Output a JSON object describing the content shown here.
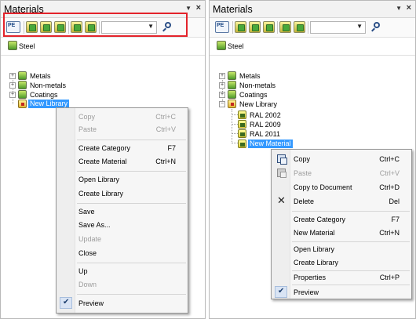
{
  "left_panel": {
    "title": "Materials",
    "pin_icon": "pin-icon",
    "close_icon": "close-icon",
    "toolbar": {
      "pe_label": "PE",
      "search_icon": "search-icon",
      "highlight_color": "#e3232b"
    },
    "header_item": "Steel",
    "tree": [
      "Metals",
      "Non-metals",
      "Coatings",
      "New Library"
    ],
    "context_menu": [
      {
        "label": "Copy",
        "shortcut": "Ctrl+C",
        "disabled": true
      },
      {
        "label": "Paste",
        "shortcut": "Ctrl+V",
        "disabled": true
      },
      {
        "label": "Create Category",
        "shortcut": "F7"
      },
      {
        "label": "Create Material",
        "shortcut": "Ctrl+N"
      },
      {
        "label": "Open Library",
        "shortcut": ""
      },
      {
        "label": "Create Library",
        "shortcut": ""
      },
      {
        "label": "Save",
        "shortcut": ""
      },
      {
        "label": "Save As...",
        "shortcut": ""
      },
      {
        "label": "Update",
        "shortcut": "",
        "disabled": true
      },
      {
        "label": "Close",
        "shortcut": ""
      },
      {
        "label": "Up",
        "shortcut": ""
      },
      {
        "label": "Down",
        "shortcut": "",
        "disabled": true
      },
      {
        "label": "Preview",
        "shortcut": "",
        "checked": true
      }
    ]
  },
  "right_panel": {
    "title": "Materials",
    "pin_icon": "pin-icon",
    "close_icon": "close-icon",
    "toolbar": {
      "pe_label": "PE",
      "search_icon": "search-icon"
    },
    "header_item": "Steel",
    "tree": [
      "Metals",
      "Non-metals",
      "Coatings",
      "New Library",
      "RAL 2002",
      "RAL 2009",
      "RAL 2011",
      "New Material"
    ],
    "context_menu": [
      {
        "label": "Copy",
        "shortcut": "Ctrl+C",
        "icon": "copy-icon"
      },
      {
        "label": "Paste",
        "shortcut": "Ctrl+V",
        "disabled": true,
        "icon": "paste-icon"
      },
      {
        "label": "Copy to Document",
        "shortcut": "Ctrl+D"
      },
      {
        "label": "Delete",
        "shortcut": "Del",
        "icon": "delete-icon"
      },
      {
        "label": "Create Category",
        "shortcut": "F7"
      },
      {
        "label": "New Material",
        "shortcut": "Ctrl+N"
      },
      {
        "label": "Open Library",
        "shortcut": ""
      },
      {
        "label": "Create Library",
        "shortcut": ""
      },
      {
        "label": "Properties",
        "shortcut": "Ctrl+P"
      },
      {
        "label": "Preview",
        "shortcut": "",
        "checked": true
      }
    ]
  }
}
